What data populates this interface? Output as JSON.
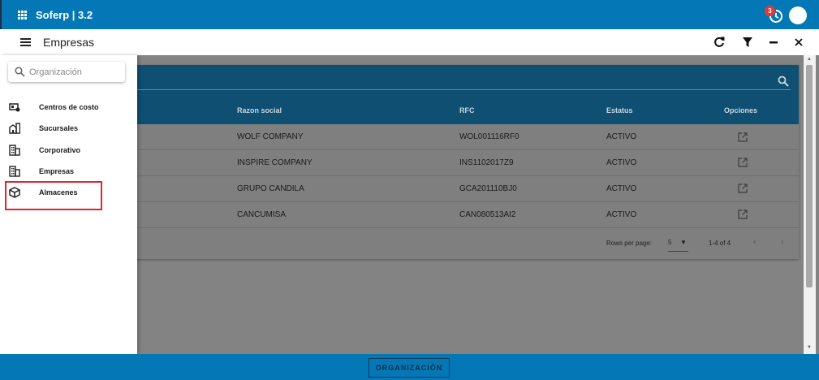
{
  "app": {
    "title": "Soferp | 3.2",
    "notification_count": "3"
  },
  "header": {
    "title": "Empresas"
  },
  "drawer": {
    "search_placeholder": "Organización",
    "items": [
      {
        "label": "Centros de costo",
        "icon": "cost-center-icon"
      },
      {
        "label": "Sucursales",
        "icon": "branch-building-icon"
      },
      {
        "label": "Corporativo",
        "icon": "building-icon"
      },
      {
        "label": "Empresas",
        "icon": "building-icon"
      },
      {
        "label": "Almacenes",
        "icon": "box-icon"
      }
    ],
    "highlighted_item": "Almacenes"
  },
  "table": {
    "columns": [
      "Razon social",
      "RFC",
      "Estatus",
      "Opciones"
    ],
    "rows": [
      {
        "razon_social": "WOLF COMPANY",
        "rfc": "WOL001116RF0",
        "estatus": "ACTIVO"
      },
      {
        "razon_social": "INSPIRE COMPANY",
        "rfc": "INS1102017Z9",
        "estatus": "ACTIVO"
      },
      {
        "razon_social": "GRUPO CANDILA",
        "rfc": "GCA201110BJ0",
        "estatus": "ACTIVO"
      },
      {
        "razon_social": "CANCUMISA",
        "rfc": "CAN080513AI2",
        "estatus": "ACTIVO"
      }
    ]
  },
  "pagination": {
    "rows_per_page_label": "Rows per page:",
    "rows_per_page": "5",
    "range": "1-4 of 4"
  },
  "footer": {
    "button_label": "ORGANIZACIÓN"
  },
  "colors": {
    "primary": "#0478b6",
    "table_header": "#0f4f72",
    "highlight": "#d8272d",
    "overlay": "#838383"
  }
}
